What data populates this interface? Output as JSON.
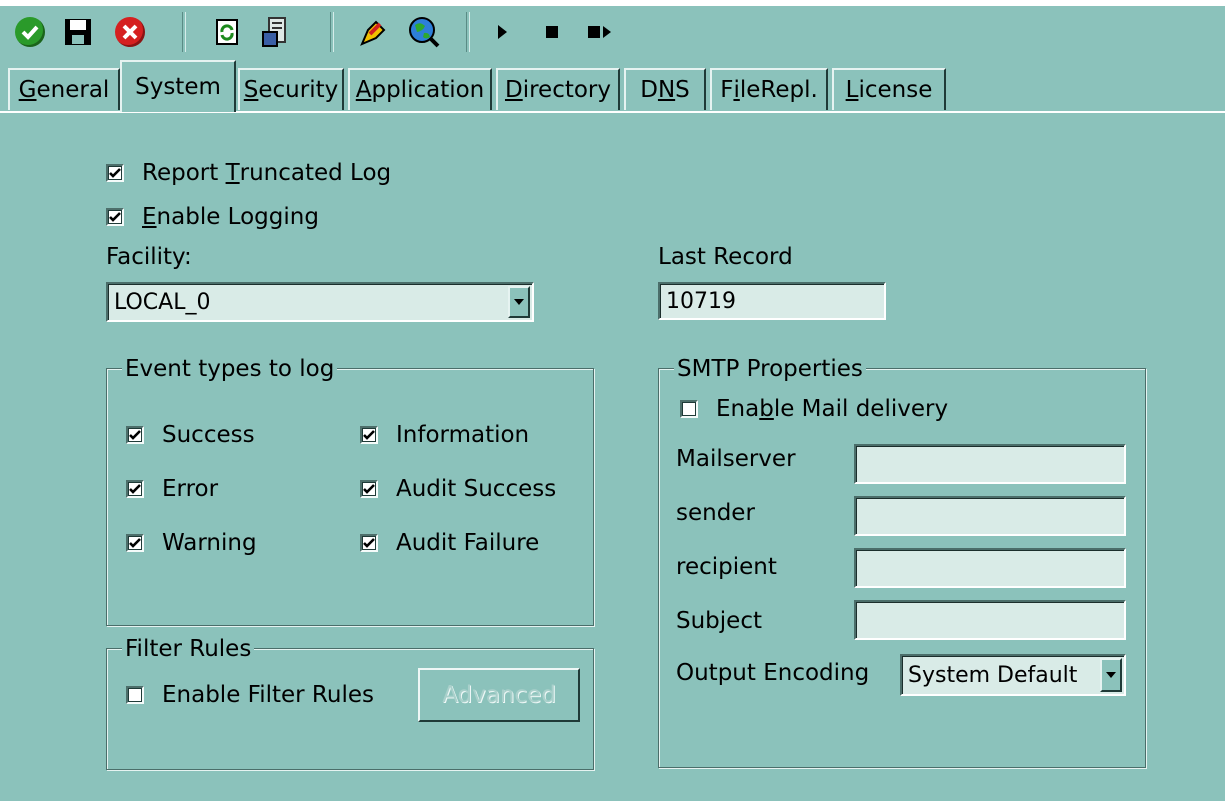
{
  "toolbar": {
    "icons": [
      "ok-icon",
      "save-icon",
      "cancel-icon",
      "refresh-icon",
      "services-icon",
      "pen-icon",
      "globe-search-icon",
      "play-icon",
      "stop-icon",
      "step-icon"
    ]
  },
  "tabs": [
    {
      "label": "General",
      "u": "G",
      "rest": "eneral"
    },
    {
      "label": "System",
      "u": "",
      "rest": "System"
    },
    {
      "label": "Security",
      "u": "S",
      "rest": "ecurity"
    },
    {
      "label": "Application",
      "u": "A",
      "rest": "pplication"
    },
    {
      "label": "Directory",
      "u": "D",
      "rest": "irectory"
    },
    {
      "label": "DNS",
      "pre": "D",
      "u": "N",
      "rest": "S"
    },
    {
      "label": "FileRepl.",
      "pre": "F",
      "u": "i",
      "rest": "leRepl."
    },
    {
      "label": "License",
      "u": "L",
      "rest": "icense"
    }
  ],
  "system": {
    "report_truncated_pre": "Report ",
    "report_truncated_u": "T",
    "report_truncated_rest": "runcated Log",
    "enable_logging_u": "E",
    "enable_logging_rest": "nable Logging",
    "facility_label": "Facility:",
    "facility_value": "LOCAL_0",
    "last_record_label": "Last Record",
    "last_record_value": "10719"
  },
  "event_types": {
    "title": "Event types to log",
    "success": "Success",
    "error": "Error",
    "warning": "Warning",
    "information": "Information",
    "audit_success": "Audit Success",
    "audit_failure": "Audit Failure"
  },
  "filter_rules": {
    "title": "Filter Rules",
    "enable_label": "Enable Filter Rules",
    "advanced_button": "Advanced"
  },
  "smtp": {
    "title": "SMTP Properties",
    "enable_pre": "Ena",
    "enable_u": "b",
    "enable_rest": "le Mail delivery",
    "mailserver_label": "Mailserver",
    "sender_label": "sender",
    "recipient_label": "recipient",
    "subject_label": "Subject",
    "encoding_label": "Output Encoding",
    "encoding_value": "System Default"
  }
}
